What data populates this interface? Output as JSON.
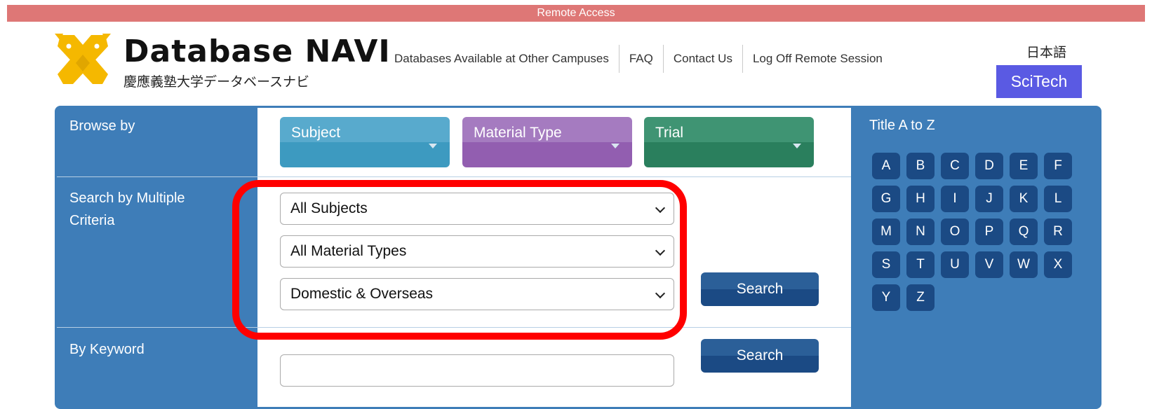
{
  "remote_bar": {
    "label": "Remote Access"
  },
  "logo": {
    "title": "Database NAVI",
    "subtitle": "慶應義塾大学データベースナビ",
    "brand_colors": [
      "#f5b800",
      "#111111"
    ]
  },
  "topnav": {
    "items": [
      {
        "label": "Databases Available at Other Campuses"
      },
      {
        "label": "FAQ"
      },
      {
        "label": "Contact Us"
      },
      {
        "label": "Log Off Remote Session"
      }
    ]
  },
  "lang_link": "日本語",
  "scitech": {
    "label": "SciTech",
    "color": "#5a5ae3"
  },
  "browse": {
    "label": "Browse by",
    "buttons": [
      {
        "label": "Subject",
        "color": "#58aacd"
      },
      {
        "label": "Material Type",
        "color": "#a57bc0"
      },
      {
        "label": "Trial",
        "color": "#3f9473"
      }
    ]
  },
  "multi": {
    "label": "Search by Multiple Criteria",
    "selects": [
      {
        "value": "All Subjects"
      },
      {
        "value": "All Material Types"
      },
      {
        "value": "Domestic & Overseas"
      }
    ],
    "search_label": "Search"
  },
  "keyword": {
    "label": "By Keyword",
    "value": "",
    "search_label": "Search"
  },
  "az": {
    "title": "Title A to Z",
    "letters": [
      "A",
      "B",
      "C",
      "D",
      "E",
      "F",
      "G",
      "H",
      "I",
      "J",
      "K",
      "L",
      "M",
      "N",
      "O",
      "P",
      "Q",
      "R",
      "S",
      "T",
      "U",
      "V",
      "W",
      "X",
      "Y",
      "Z"
    ]
  },
  "highlight_color": "#ff0000"
}
